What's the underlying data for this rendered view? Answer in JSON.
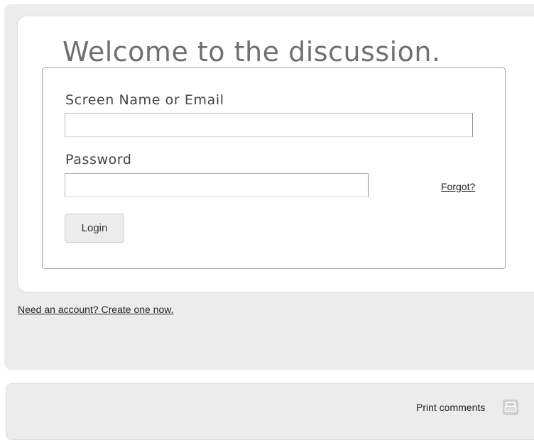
{
  "login": {
    "welcome_title": "Welcome to the discussion.",
    "username_label": "Screen Name or Email",
    "username_value": "",
    "password_label": "Password",
    "password_value": "",
    "forgot_link": "Forgot?",
    "login_button": "Login"
  },
  "account": {
    "create_link": "Need an account? Create one now."
  },
  "comments": {
    "print_label": "Print comments",
    "print_icon": "printer-icon"
  },
  "colors": {
    "panel_bg": "#ececec",
    "card_bg": "#ffffff",
    "title_text": "#707070",
    "label_text": "#444444"
  }
}
